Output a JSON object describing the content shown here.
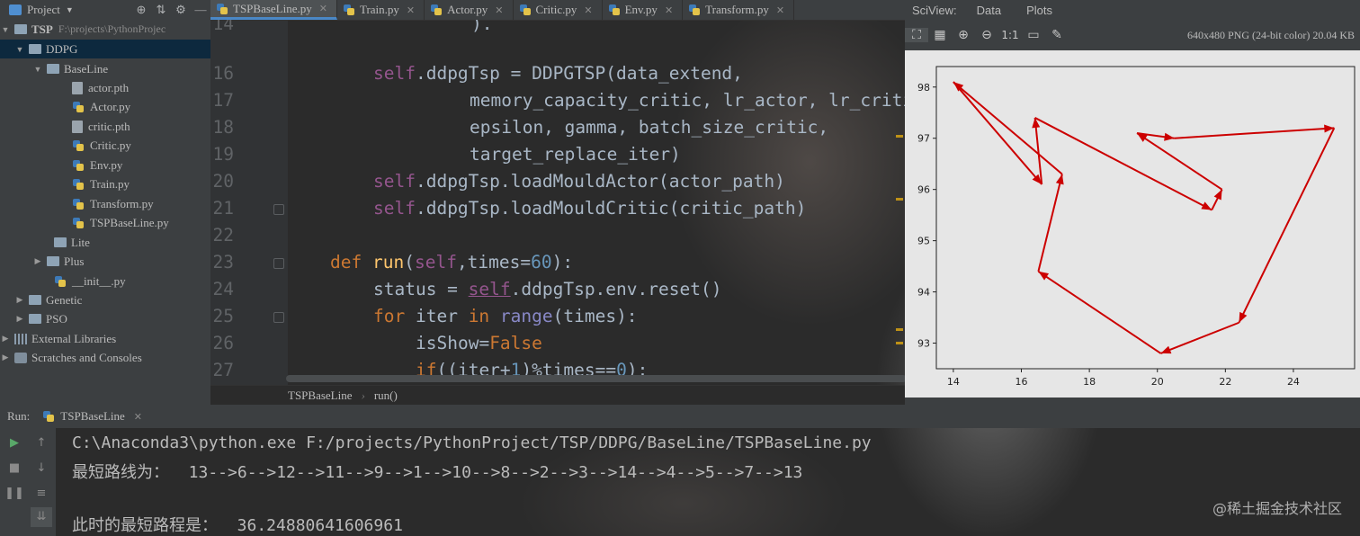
{
  "project_header": {
    "title": "Project"
  },
  "tabs": [
    {
      "label": "TSPBaseLine.py",
      "active": true
    },
    {
      "label": "Train.py"
    },
    {
      "label": "Actor.py"
    },
    {
      "label": "Critic.py"
    },
    {
      "label": "Env.py"
    },
    {
      "label": "Transform.py"
    }
  ],
  "tree": {
    "root": {
      "name": "TSP",
      "path": "F:\\projects\\PythonProjec"
    },
    "items": [
      "DDPG",
      "BaseLine",
      "actor.pth",
      "Actor.py",
      "critic.pth",
      "Critic.py",
      "Env.py",
      "Train.py",
      "Transform.py",
      "TSPBaseLine.py",
      "Lite",
      "Plus",
      "__init__.py",
      "Genetic",
      "PSO",
      "External Libraries",
      "Scratches and Consoles"
    ]
  },
  "editor": {
    "line_numbers": [
      "14",
      "16",
      "17",
      "18",
      "19",
      "20",
      "21",
      "22",
      "23",
      "24",
      "25",
      "26",
      "27"
    ],
    "l14": ")."
  },
  "breadcrumb": {
    "file": "TSPBaseLine",
    "fn": "run()"
  },
  "sciview": {
    "title": "SciView:",
    "tabs": [
      "Data",
      "Plots"
    ],
    "one_to_one": "1:1",
    "image_info": "640x480 PNG (24-bit color) 20.04 KB"
  },
  "chart_data": {
    "type": "line",
    "title": "",
    "xlabel": "",
    "ylabel": "",
    "xlim": [
      13.5,
      25.8
    ],
    "ylim": [
      92.5,
      98.4
    ],
    "xticks": [
      "14",
      "16",
      "18",
      "20",
      "22",
      "24"
    ],
    "yticks": [
      "93",
      "94",
      "95",
      "96",
      "97",
      "98"
    ],
    "color": "#cc0000",
    "points": [
      {
        "x": 14.0,
        "y": 98.1
      },
      {
        "x": 16.6,
        "y": 96.1
      },
      {
        "x": 16.4,
        "y": 97.4
      },
      {
        "x": 21.6,
        "y": 95.6
      },
      {
        "x": 21.9,
        "y": 96.0
      },
      {
        "x": 19.4,
        "y": 97.1
      },
      {
        "x": 20.5,
        "y": 97.0
      },
      {
        "x": 25.2,
        "y": 97.2
      },
      {
        "x": 22.4,
        "y": 93.4
      },
      {
        "x": 20.1,
        "y": 92.8
      },
      {
        "x": 16.5,
        "y": 94.4
      },
      {
        "x": 17.2,
        "y": 96.3
      },
      {
        "x": 14.0,
        "y": 98.1
      }
    ]
  },
  "run": {
    "label": "Run:",
    "config": "TSPBaseLine",
    "lines": [
      "C:\\Anaconda3\\python.exe F:/projects/PythonProject/TSP/DDPG/BaseLine/TSPBaseLine.py",
      "最短路线为：  13-->6-->12-->11-->9-->1-->10-->8-->2-->3-->14-->4-->5-->7-->13",
      "",
      "此时的最短路程是：  36.24880641606961"
    ]
  },
  "watermark": "@稀土掘金技术社区"
}
